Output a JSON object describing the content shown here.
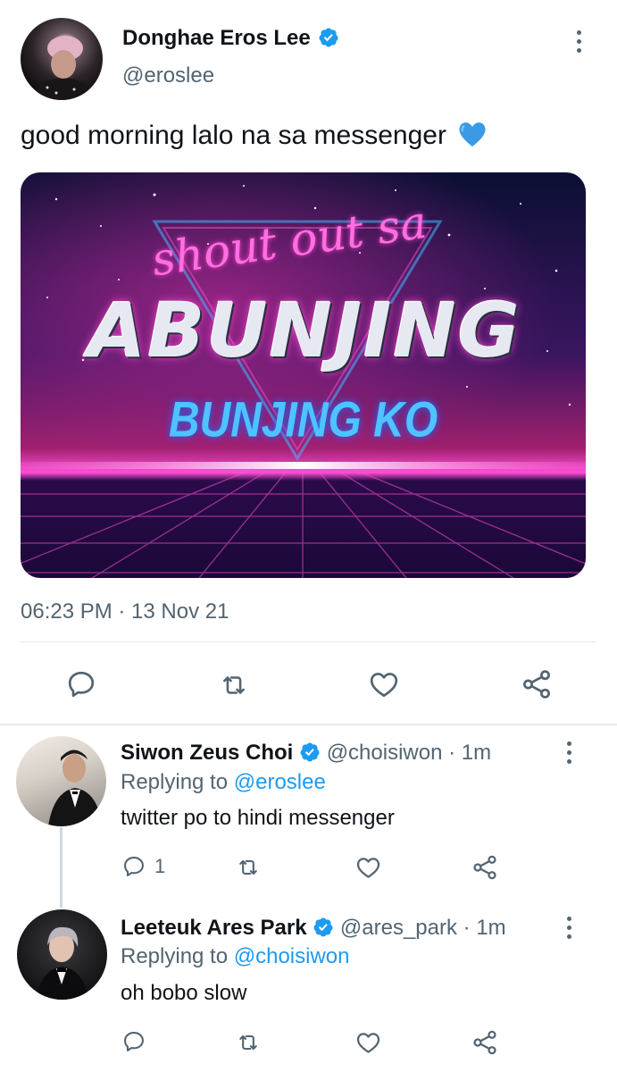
{
  "main_tweet": {
    "display_name": "Donghae Eros Lee",
    "handle": "@eroslee",
    "text": "good morning lalo na sa messenger",
    "emoji": "💙",
    "timestamp": "06:23 PM · 13 Nov 21",
    "media": {
      "script_line": "shout out sa",
      "headline": "ABUNJING",
      "subline": "BUNJING KO"
    }
  },
  "replies": [
    {
      "display_name": "Siwon Zeus Choi",
      "handle": "@choisiwon",
      "time": "· 1m",
      "replying_prefix": "Replying to",
      "replying_to": "@eroslee",
      "text": "twitter po to hindi messenger",
      "reply_count": "1"
    },
    {
      "display_name": "Leeteuk Ares Park",
      "handle": "@ares_park",
      "time": "· 1m",
      "replying_prefix": "Replying to",
      "replying_to": "@choisiwon",
      "text": "oh bobo slow",
      "reply_count": ""
    }
  ],
  "icons": {
    "reply": "reply-icon",
    "retweet": "retweet-icon",
    "like": "like-icon",
    "share": "share-icon",
    "verified": "verified-badge-icon",
    "more": "more-options-icon"
  },
  "colors": {
    "accent": "#1d9bf0",
    "text": "#0f1419",
    "secondary": "#536471"
  }
}
